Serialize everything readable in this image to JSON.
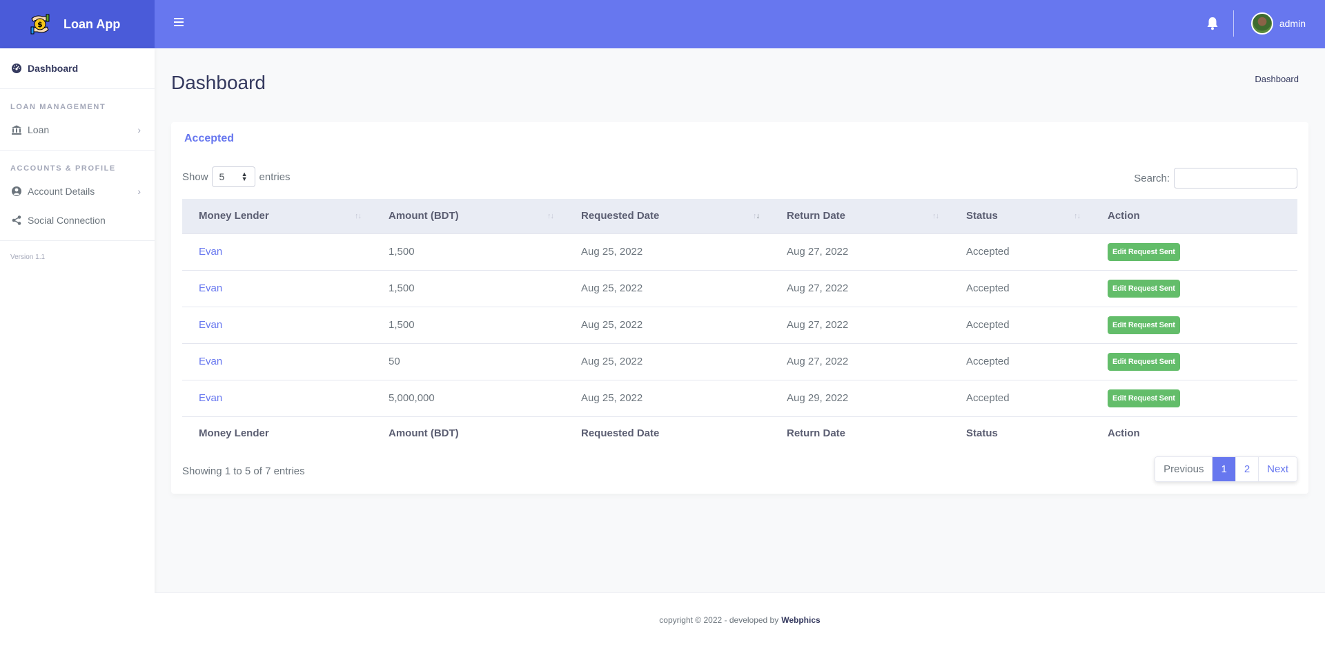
{
  "app": {
    "name": "Loan App"
  },
  "topbar": {
    "user_name": "admin",
    "menu_icon": "hamburger-icon",
    "notification_icon": "bell-icon"
  },
  "sidebar": {
    "items": [
      {
        "label": "Dashboard",
        "icon": "dashboard-gauge-icon",
        "active": true
      }
    ],
    "sections": [
      {
        "header": "LOAN MANAGEMENT",
        "items": [
          {
            "label": "Loan",
            "icon": "bank-icon",
            "has_submenu": true
          }
        ]
      },
      {
        "header": "ACCOUNTS & PROFILE",
        "items": [
          {
            "label": "Account Details",
            "icon": "user-circle-icon",
            "has_submenu": true
          },
          {
            "label": "Social Connection",
            "icon": "share-icon",
            "has_submenu": false
          }
        ]
      }
    ],
    "version": "Version 1.1"
  },
  "page": {
    "title": "Dashboard",
    "breadcrumb": "Dashboard"
  },
  "card": {
    "title": "Accepted",
    "show_label": "Show",
    "entries_label": "entries",
    "page_size": "5",
    "search_label": "Search:",
    "search_value": "",
    "columns": [
      "Money Lender",
      "Amount (BDT)",
      "Requested Date",
      "Return Date",
      "Status",
      "Action"
    ],
    "sorted_column": "Requested Date",
    "sorted_direction": "descending",
    "rows": [
      {
        "lender": "Evan",
        "amount": "1,500",
        "requested": "Aug 25, 2022",
        "return": "Aug 27, 2022",
        "status": "Accepted",
        "action": "Edit Request Sent"
      },
      {
        "lender": "Evan",
        "amount": "1,500",
        "requested": "Aug 25, 2022",
        "return": "Aug 27, 2022",
        "status": "Accepted",
        "action": "Edit Request Sent"
      },
      {
        "lender": "Evan",
        "amount": "1,500",
        "requested": "Aug 25, 2022",
        "return": "Aug 27, 2022",
        "status": "Accepted",
        "action": "Edit Request Sent"
      },
      {
        "lender": "Evan",
        "amount": "50",
        "requested": "Aug 25, 2022",
        "return": "Aug 27, 2022",
        "status": "Accepted",
        "action": "Edit Request Sent"
      },
      {
        "lender": "Evan",
        "amount": "5,000,000",
        "requested": "Aug 25, 2022",
        "return": "Aug 29, 2022",
        "status": "Accepted",
        "action": "Edit Request Sent"
      }
    ],
    "info": "Showing 1 to 5 of 7 entries",
    "pagination": {
      "previous": "Previous",
      "pages": [
        "1",
        "2"
      ],
      "current": "1",
      "next": "Next"
    }
  },
  "footer": {
    "text": "copyright © 2022 - developed by",
    "brand": "Webphics"
  },
  "colors": {
    "primary": "#6777ef",
    "brand_dark": "#4a5bd9",
    "success": "#63bd6a"
  }
}
